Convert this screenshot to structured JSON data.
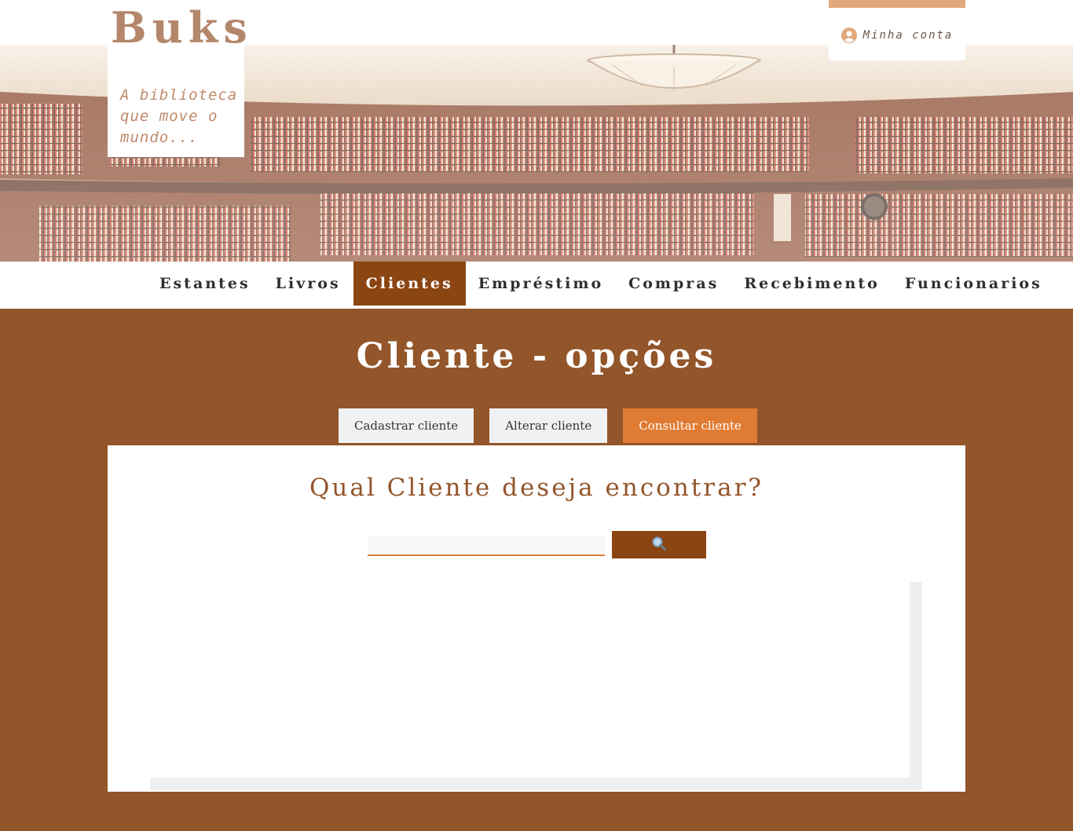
{
  "brand": {
    "title": "Buks",
    "tagline": "A biblioteca que move o mundo..."
  },
  "account": {
    "label": "Minha conta",
    "icon": "user-circle-icon"
  },
  "nav": {
    "items": [
      {
        "label": "Estantes",
        "active": false
      },
      {
        "label": "Livros",
        "active": false
      },
      {
        "label": "Clientes",
        "active": true
      },
      {
        "label": "Empréstimo",
        "active": false
      },
      {
        "label": "Compras",
        "active": false
      },
      {
        "label": "Recebimento",
        "active": false
      },
      {
        "label": "Funcionarios",
        "active": false
      }
    ]
  },
  "page": {
    "title": "Cliente - opções"
  },
  "tabs": [
    {
      "label": "Cadastrar cliente",
      "active": false
    },
    {
      "label": "Alterar cliente",
      "active": false
    },
    {
      "label": "Consultar cliente",
      "active": true
    }
  ],
  "search": {
    "heading": "Qual Cliente deseja encontrar?",
    "value": "",
    "placeholder": "",
    "button_icon": "magnifier-icon"
  },
  "colors": {
    "brown": "#93552a",
    "nav_active": "#8b4513",
    "accent_orange": "#e07b33",
    "logo_tan": "#b3876a",
    "account_bar": "#e2a77d"
  }
}
